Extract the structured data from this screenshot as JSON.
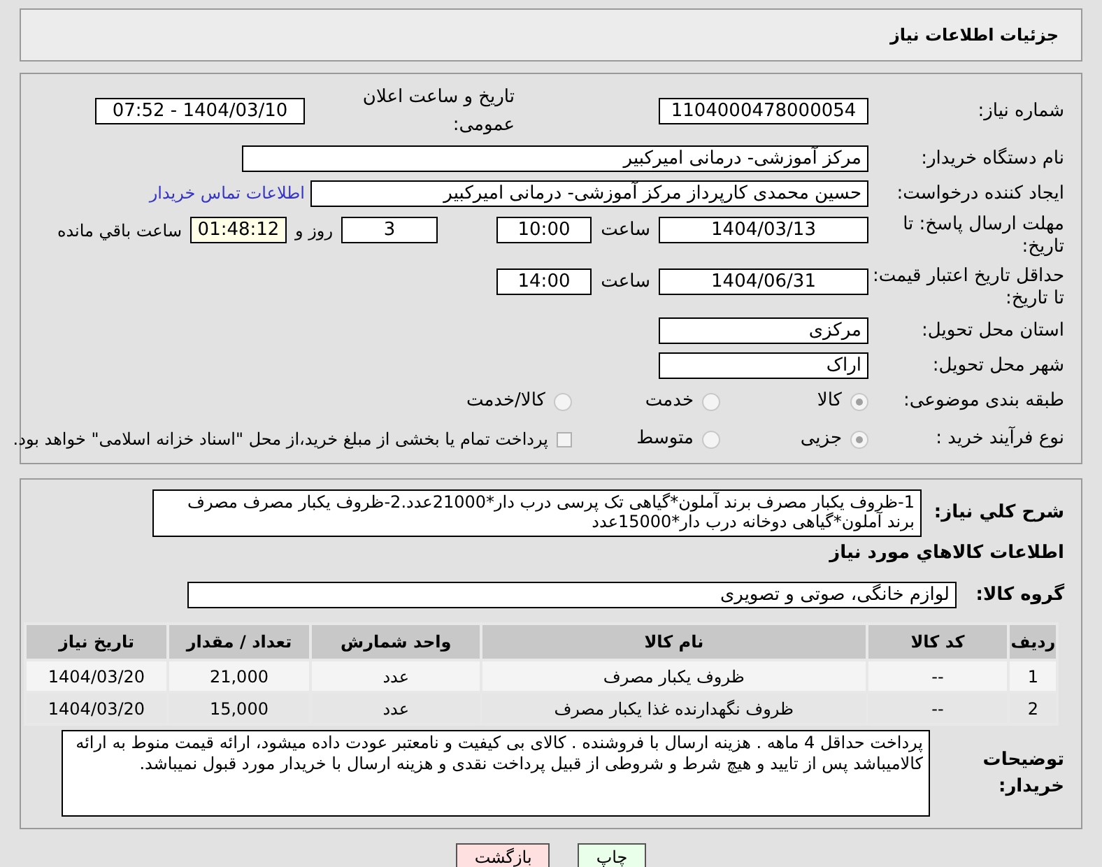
{
  "header": {
    "title": "جزئیات اطلاعات نیاز"
  },
  "form": {
    "need_number": {
      "label": "شماره نیاز:",
      "value": "1104000478000054"
    },
    "announce": {
      "label": "تاریخ و ساعت اعلان عمومی:",
      "value": "1404/03/10 - 07:52"
    },
    "buyer_org": {
      "label": "نام دستگاه خریدار:",
      "value": "مرکز آموزشی- درمانی امیرکبیر"
    },
    "creator": {
      "label": "ایجاد کننده درخواست:",
      "value": "حسین  محمدی کارپرداز مرکز آموزشی- درمانی امیرکبیر",
      "link": "اطلاعات تماس خریدار"
    },
    "deadline": {
      "label": "مهلت ارسال پاسخ: تا تاریخ:",
      "date": "1404/03/13",
      "time_label": "ساعت",
      "time": "10:00",
      "days": "3",
      "days_label": "روز و",
      "remaining": "01:48:12",
      "remaining_label": "ساعت باقي مانده"
    },
    "validity": {
      "label": "حداقل تاریخ اعتبار قیمت: تا تاریخ:",
      "date": "1404/06/31",
      "time_label": "ساعت",
      "time": "14:00"
    },
    "province": {
      "label": "استان محل تحویل:",
      "value": "مرکزی"
    },
    "city": {
      "label": "شهر محل تحویل:",
      "value": "اراک"
    },
    "category": {
      "label": "طبقه بندی موضوعی:",
      "options": [
        {
          "label": "کالا",
          "selected": true
        },
        {
          "label": "خدمت",
          "selected": false
        },
        {
          "label": "کالا/خدمت",
          "selected": false
        }
      ]
    },
    "purchase_type": {
      "label": "نوع فرآیند خرید :",
      "options": [
        {
          "label": "جزیی",
          "selected": true
        },
        {
          "label": "متوسط",
          "selected": false
        }
      ],
      "treasury": {
        "label": "پرداخت تمام یا بخشی از مبلغ خرید،از محل \"اسناد خزانه اسلامی\" خواهد بود.",
        "checked": false
      }
    }
  },
  "details": {
    "description": {
      "label": "شرح کلي نیاز:",
      "value": "1-ظروف یکبار مصرف برند آملون*گیاهی تک پرسی درب دار*21000عدد.2-ظروف یکبار مصرف مصرف برند آملون*گیاهی دوخانه درب دار*15000عدد"
    },
    "goods_heading": "اطلاعات کالاهاي مورد نیاز",
    "goods_group": {
      "label": "گروه کالا:",
      "value": "لوازم خانگی، صوتی و تصویری"
    },
    "table": {
      "columns": [
        "ردیف",
        "کد کالا",
        "نام کالا",
        "واحد شمارش",
        "تعداد / مقدار",
        "تاریخ نیاز"
      ],
      "rows": [
        [
          "1",
          "--",
          "ظروف یکبار مصرف",
          "عدد",
          "21,000",
          "1404/03/20"
        ],
        [
          "2",
          "--",
          "ظروف نگهدارنده غذا یکبار مصرف",
          "عدد",
          "15,000",
          "1404/03/20"
        ]
      ]
    },
    "buyer_notes": {
      "label": "توضیحات خریدار:",
      "value": "پرداخت حداقل 4 ماهه . هزینه ارسال با فروشنده .  کالای بی کیفیت و نامعتبر عودت داده میشود، ارائه قیمت منوط به ارائه کالامیباشد پس از تایید و هیچ شرط و شروطی از قبیل پرداخت نقدی و هزینه ارسال با خریدار مورد قبول نمیباشد."
    }
  },
  "buttons": [
    {
      "label": "چاپ",
      "kind": "print"
    },
    {
      "label": "بازگشت",
      "kind": "back"
    }
  ]
}
